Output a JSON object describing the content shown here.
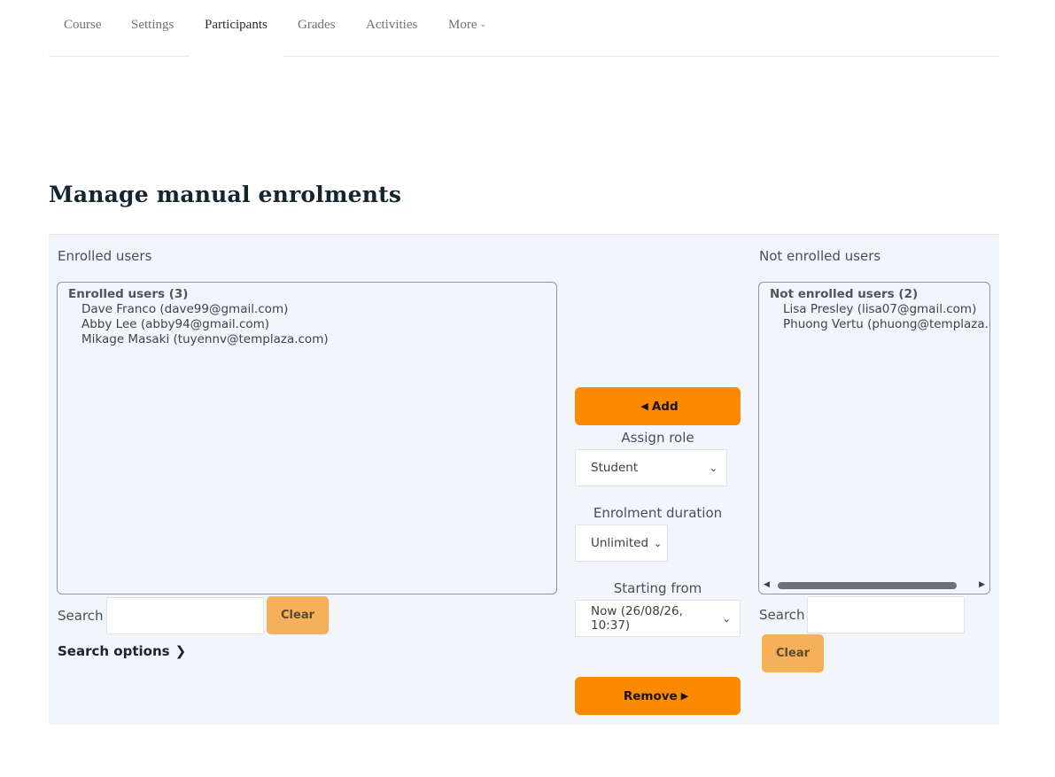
{
  "nav": {
    "tabs": [
      {
        "label": "Course"
      },
      {
        "label": "Settings"
      },
      {
        "label": "Participants"
      },
      {
        "label": "Grades"
      },
      {
        "label": "Activities"
      },
      {
        "label": "More"
      }
    ],
    "active": "Participants"
  },
  "page": {
    "title": "Manage manual enrolments"
  },
  "enrolled": {
    "heading": "Enrolled users",
    "group_label": "Enrolled users (3)",
    "users": [
      "Dave Franco (dave99@gmail.com)",
      "Abby Lee (abby94@gmail.com)",
      "Mikage Masaki (tuyennv@templaza.com)"
    ],
    "search_label": "Search",
    "search_value": "",
    "clear_label": "Clear",
    "search_options_label": "Search options"
  },
  "not_enrolled": {
    "heading": "Not enrolled users",
    "group_label": "Not enrolled users (2)",
    "users": [
      "Lisa Presley (lisa07@gmail.com)",
      "Phuong Vertu (phuong@templaza.com)"
    ],
    "search_label": "Search",
    "search_value": "",
    "clear_label": "Clear"
  },
  "controls": {
    "add_label": "Add",
    "remove_label": "Remove",
    "assign_role_label": "Assign role",
    "assign_role_value": "Student",
    "enrolment_duration_label": "Enrolment duration",
    "enrolment_duration_value": "Unlimited",
    "starting_from_label": "Starting from",
    "starting_from_value": "Now (26/08/26, 10:37)"
  },
  "colors": {
    "primary_button": "#fb8a00",
    "clear_button": "#f6b059",
    "panel_bg": "#f2f5f9",
    "title": "#13262f"
  }
}
